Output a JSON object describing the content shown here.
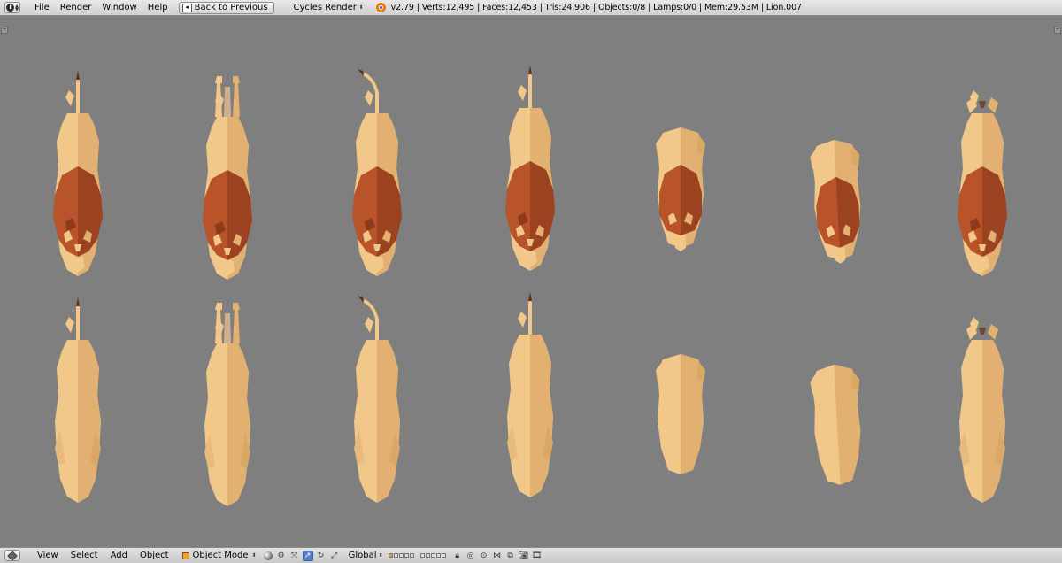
{
  "header": {
    "info_icon": "info-icon",
    "menus": [
      "File",
      "Render",
      "Window",
      "Help"
    ],
    "back_button": "Back to Previous",
    "render_engine": "Cycles Render",
    "logo_icon": "blender-logo-icon",
    "stats": "v2.79 | Verts:12,495 | Faces:12,453 | Tris:24,906 | Objects:0/8 | Lamps:0/0 | Mem:29.53M | Lion.007"
  },
  "viewport": {
    "background_color": "#7f7f7f",
    "content": "Top-down view of low-poly lion models (with manes) and lioness models (without manes)",
    "colors": {
      "body": "#f1c889",
      "body_shadow": "#d9a867",
      "mane": "#b8532a",
      "mane_dark": "#8e3a1b",
      "tail_tip": "#6a2a12"
    }
  },
  "footer": {
    "editor_icon": "3d-view-editor-icon",
    "menus": [
      "View",
      "Select",
      "Add",
      "Object"
    ],
    "mode": "Object Mode",
    "orientation": "Global"
  }
}
